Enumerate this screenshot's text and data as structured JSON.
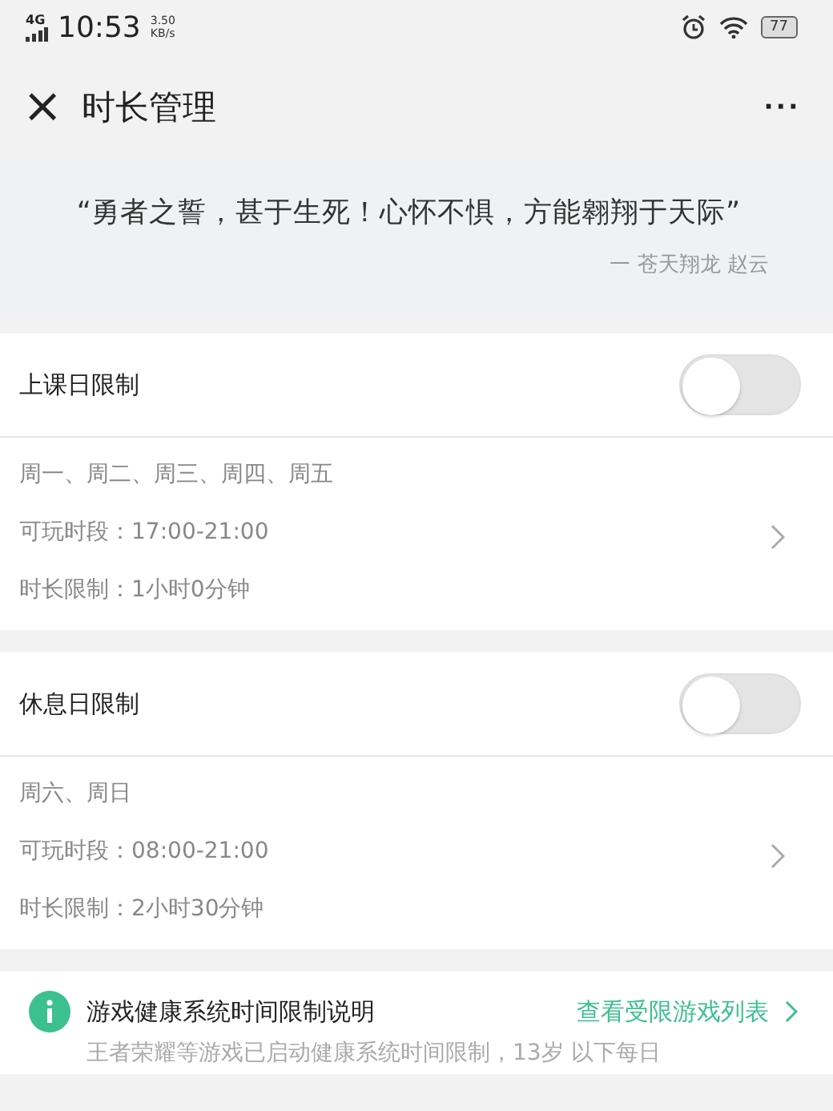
{
  "status_bar": {
    "network": "4G",
    "time": "10:53",
    "speed_value": "3.50",
    "speed_unit": "KB/s",
    "battery": "77"
  },
  "header": {
    "close": "×",
    "title": "时长管理",
    "menu": "···"
  },
  "quote": {
    "text": "“勇者之誓，甚于生死！心怀不惧，方能翱翔于天际”",
    "author": "一 苍天翔龙 赵云"
  },
  "limits": [
    {
      "title": "上课日限制",
      "on": false,
      "days": "周一、周二、周三、周四、周五",
      "period": "可玩时段：17:00-21:00",
      "duration": "时长限制：1小时0分钟"
    },
    {
      "title": "休息日限制",
      "on": false,
      "days": "周六、周日",
      "period": "可玩时段：08:00-21:00",
      "duration": "时长限制：2小时30分钟"
    }
  ],
  "notice": {
    "title": "游戏健康系统时间限制说明",
    "link": "查看受限游戏列表",
    "text": "王者荣耀等游戏已启动健康系统时间限制，13岁 以下每日"
  }
}
